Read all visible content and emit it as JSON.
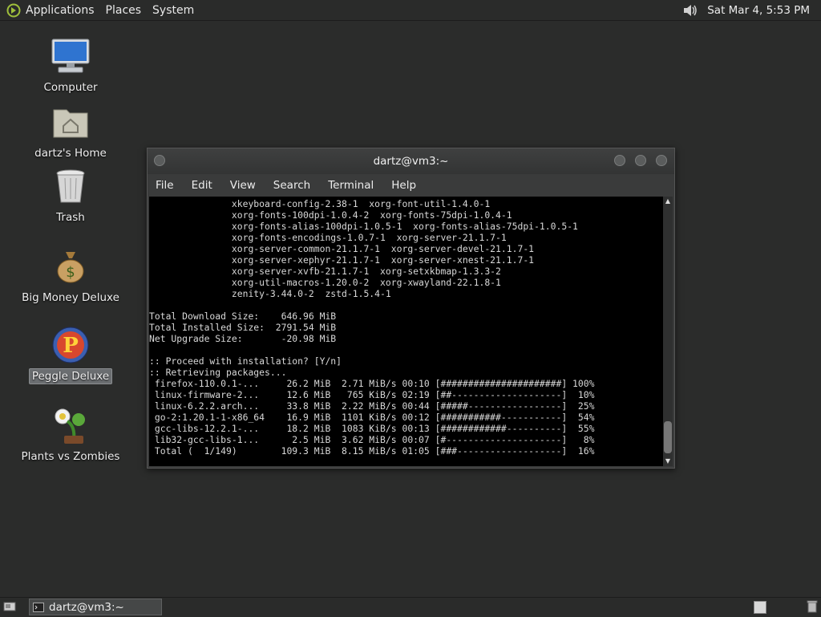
{
  "top_panel": {
    "menus": [
      "Applications",
      "Places",
      "System"
    ],
    "clock": "Sat Mar  4,  5:53 PM"
  },
  "desktop": {
    "icons": [
      {
        "label": "Computer",
        "icon": "computer-icon"
      },
      {
        "label": "dartz's Home",
        "icon": "home-folder-icon"
      },
      {
        "label": "Trash",
        "icon": "trash-icon"
      },
      {
        "label": "Big Money Deluxe",
        "icon": "money-bag-icon"
      },
      {
        "label": "Peggle Deluxe",
        "icon": "peggle-icon",
        "selected": true
      },
      {
        "label": "Plants vs Zombies",
        "icon": "plants-icon"
      }
    ]
  },
  "terminal": {
    "title": "dartz@vm3:~",
    "menus": [
      "File",
      "Edit",
      "View",
      "Search",
      "Terminal",
      "Help"
    ],
    "lines": [
      "               xkeyboard-config-2.38-1  xorg-font-util-1.4.0-1",
      "               xorg-fonts-100dpi-1.0.4-2  xorg-fonts-75dpi-1.0.4-1",
      "               xorg-fonts-alias-100dpi-1.0.5-1  xorg-fonts-alias-75dpi-1.0.5-1",
      "               xorg-fonts-encodings-1.0.7-1  xorg-server-21.1.7-1",
      "               xorg-server-common-21.1.7-1  xorg-server-devel-21.1.7-1",
      "               xorg-server-xephyr-21.1.7-1  xorg-server-xnest-21.1.7-1",
      "               xorg-server-xvfb-21.1.7-1  xorg-setxkbmap-1.3.3-2",
      "               xorg-util-macros-1.20.0-2  xorg-xwayland-22.1.8-1",
      "               zenity-3.44.0-2  zstd-1.5.4-1",
      "",
      "Total Download Size:    646.96 MiB",
      "Total Installed Size:  2791.54 MiB",
      "Net Upgrade Size:       -20.98 MiB",
      "",
      ":: Proceed with installation? [Y/n]",
      ":: Retrieving packages...",
      " firefox-110.0.1-...     26.2 MiB  2.71 MiB/s 00:10 [######################] 100%",
      " linux-firmware-2...     12.6 MiB   765 KiB/s 02:19 [##--------------------]  10%",
      " linux-6.2.2.arch...     33.8 MiB  2.22 MiB/s 00:44 [#####-----------------]  25%",
      " go-2:1.20.1-1-x86_64    16.9 MiB  1101 KiB/s 00:12 [###########-----------]  54%",
      " gcc-libs-12.2.1-...     18.2 MiB  1083 KiB/s 00:13 [############----------]  55%",
      " lib32-gcc-libs-1...      2.5 MiB  3.62 MiB/s 00:07 [#---------------------]   8%",
      " Total (  1/149)        109.3 MiB  8.15 MiB/s 01:05 [###-------------------]  16%"
    ]
  },
  "taskbar": {
    "window_label": "dartz@vm3:~"
  }
}
